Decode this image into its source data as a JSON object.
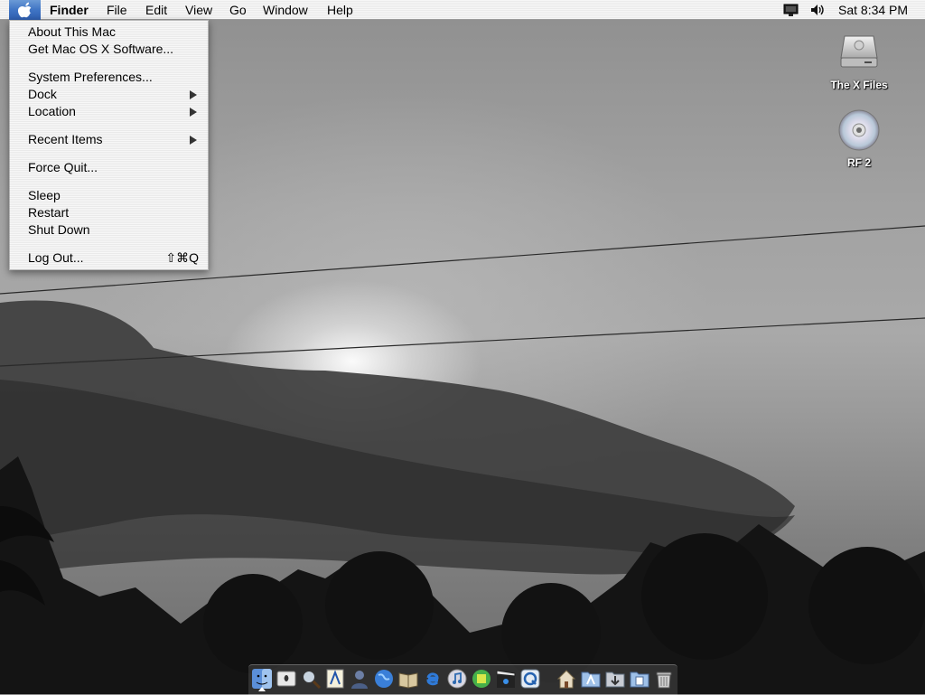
{
  "menubar": {
    "apple_icon": "apple-logo-icon",
    "app_name": "Finder",
    "menus": [
      "File",
      "Edit",
      "View",
      "Go",
      "Window",
      "Help"
    ],
    "status_icons": [
      "display-icon",
      "volume-icon"
    ],
    "clock": "Sat 8:34 PM"
  },
  "apple_menu": {
    "items": [
      {
        "label": "About This Mac"
      },
      {
        "label": "Get Mac OS X Software..."
      },
      {
        "label": "System Preferences..."
      },
      {
        "label": "Dock",
        "submenu": true
      },
      {
        "label": "Location",
        "submenu": true
      },
      {
        "label": "Recent Items",
        "submenu": true
      },
      {
        "label": "Force Quit..."
      },
      {
        "label": "Sleep"
      },
      {
        "label": "Restart"
      },
      {
        "label": "Shut Down"
      },
      {
        "label": "Log Out...",
        "shortcut": "⇧⌘Q"
      }
    ]
  },
  "desktop_icons": [
    {
      "label": "The X Files",
      "icon": "hard-drive-icon"
    },
    {
      "label": "RF 2",
      "icon": "cd-icon"
    }
  ],
  "dock": {
    "items": [
      "finder-icon",
      "mac-os-x-icon",
      "sherlock-icon",
      "textedit-icon",
      "address-book-icon",
      "globe-icon",
      "dictionary-icon",
      "internet-explorer-icon",
      "itunes-icon",
      "chess-icon",
      "imovie-icon",
      "quicktime-icon",
      "home-folder-icon",
      "applications-folder-icon",
      "downloads-folder-icon",
      "documents-folder-icon",
      "trash-icon"
    ]
  },
  "colors": {
    "menu_highlight": "#3f74c4",
    "menu_text": "#000000",
    "desktop_label": "#ffffff"
  }
}
